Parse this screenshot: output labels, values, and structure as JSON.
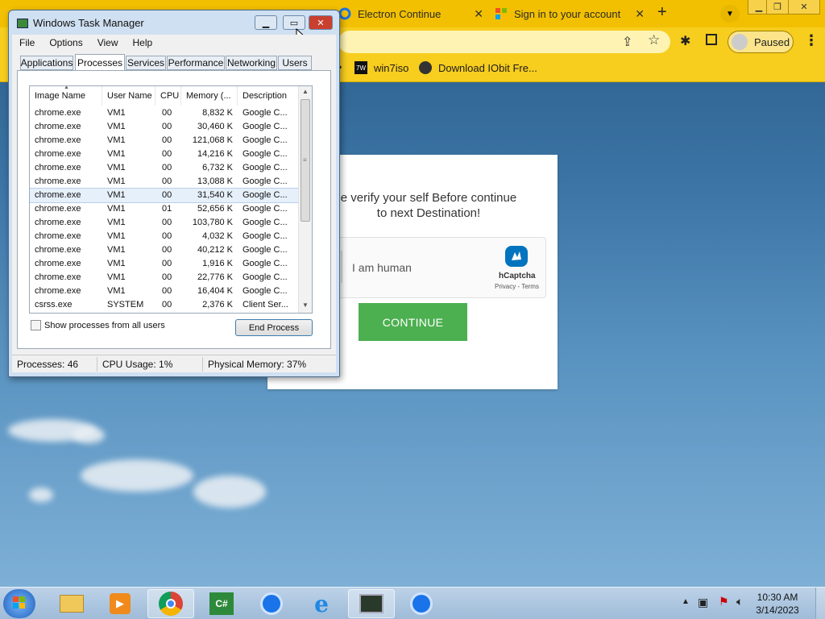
{
  "browser": {
    "tabs": [
      {
        "label": "Electron Continue"
      },
      {
        "label": "Sign in to your account"
      }
    ],
    "profile_label": "Paused",
    "bookmarks": [
      {
        "label": "win7iso"
      },
      {
        "label": "Download IObit Fre..."
      }
    ]
  },
  "page": {
    "verify_line1": "e verify your self Before continue",
    "verify_line2": "to next Destination!",
    "captcha_label": "I am human",
    "captcha_brand": "hCaptcha",
    "captcha_links": "Privacy - Terms",
    "continue_label": "CONTINUE"
  },
  "task_manager": {
    "title": "Windows Task Manager",
    "menu": [
      "File",
      "Options",
      "View",
      "Help"
    ],
    "tabs": [
      "Applications",
      "Processes",
      "Services",
      "Performance",
      "Networking",
      "Users"
    ],
    "active_tab": "Processes",
    "columns": [
      "Image Name",
      "User Name",
      "CPU",
      "Memory (...",
      "Description"
    ],
    "rows": [
      {
        "name": "chrome.exe",
        "user": "VM1",
        "cpu": "00",
        "mem": "8,832 K",
        "desc": "Google C..."
      },
      {
        "name": "chrome.exe",
        "user": "VM1",
        "cpu": "00",
        "mem": "30,460 K",
        "desc": "Google C..."
      },
      {
        "name": "chrome.exe",
        "user": "VM1",
        "cpu": "00",
        "mem": "121,068 K",
        "desc": "Google C..."
      },
      {
        "name": "chrome.exe",
        "user": "VM1",
        "cpu": "00",
        "mem": "14,216 K",
        "desc": "Google C..."
      },
      {
        "name": "chrome.exe",
        "user": "VM1",
        "cpu": "00",
        "mem": "6,732 K",
        "desc": "Google C..."
      },
      {
        "name": "chrome.exe",
        "user": "VM1",
        "cpu": "00",
        "mem": "13,088 K",
        "desc": "Google C..."
      },
      {
        "name": "chrome.exe",
        "user": "VM1",
        "cpu": "00",
        "mem": "31,540 K",
        "desc": "Google C...",
        "selected": true
      },
      {
        "name": "chrome.exe",
        "user": "VM1",
        "cpu": "01",
        "mem": "52,656 K",
        "desc": "Google C..."
      },
      {
        "name": "chrome.exe",
        "user": "VM1",
        "cpu": "00",
        "mem": "103,780 K",
        "desc": "Google C..."
      },
      {
        "name": "chrome.exe",
        "user": "VM1",
        "cpu": "00",
        "mem": "4,032 K",
        "desc": "Google C..."
      },
      {
        "name": "chrome.exe",
        "user": "VM1",
        "cpu": "00",
        "mem": "40,212 K",
        "desc": "Google C..."
      },
      {
        "name": "chrome.exe",
        "user": "VM1",
        "cpu": "00",
        "mem": "1,916 K",
        "desc": "Google C..."
      },
      {
        "name": "chrome.exe",
        "user": "VM1",
        "cpu": "00",
        "mem": "22,776 K",
        "desc": "Google C..."
      },
      {
        "name": "chrome.exe",
        "user": "VM1",
        "cpu": "00",
        "mem": "16,404 K",
        "desc": "Google C..."
      },
      {
        "name": "csrss.exe",
        "user": "SYSTEM",
        "cpu": "00",
        "mem": "2,376 K",
        "desc": "Client Ser..."
      }
    ],
    "show_all_label": "Show processes from all users",
    "end_process_label": "End Process",
    "status": {
      "processes": "Processes: 46",
      "cpu": "CPU Usage: 1%",
      "memory": "Physical Memory: 37%"
    }
  },
  "taskbar": {
    "time": "10:30 AM",
    "date": "3/14/2023"
  },
  "colors": {
    "chrome_accent": "#f4c400",
    "continue_green": "#4caf50",
    "close_red": "#c9402f"
  }
}
